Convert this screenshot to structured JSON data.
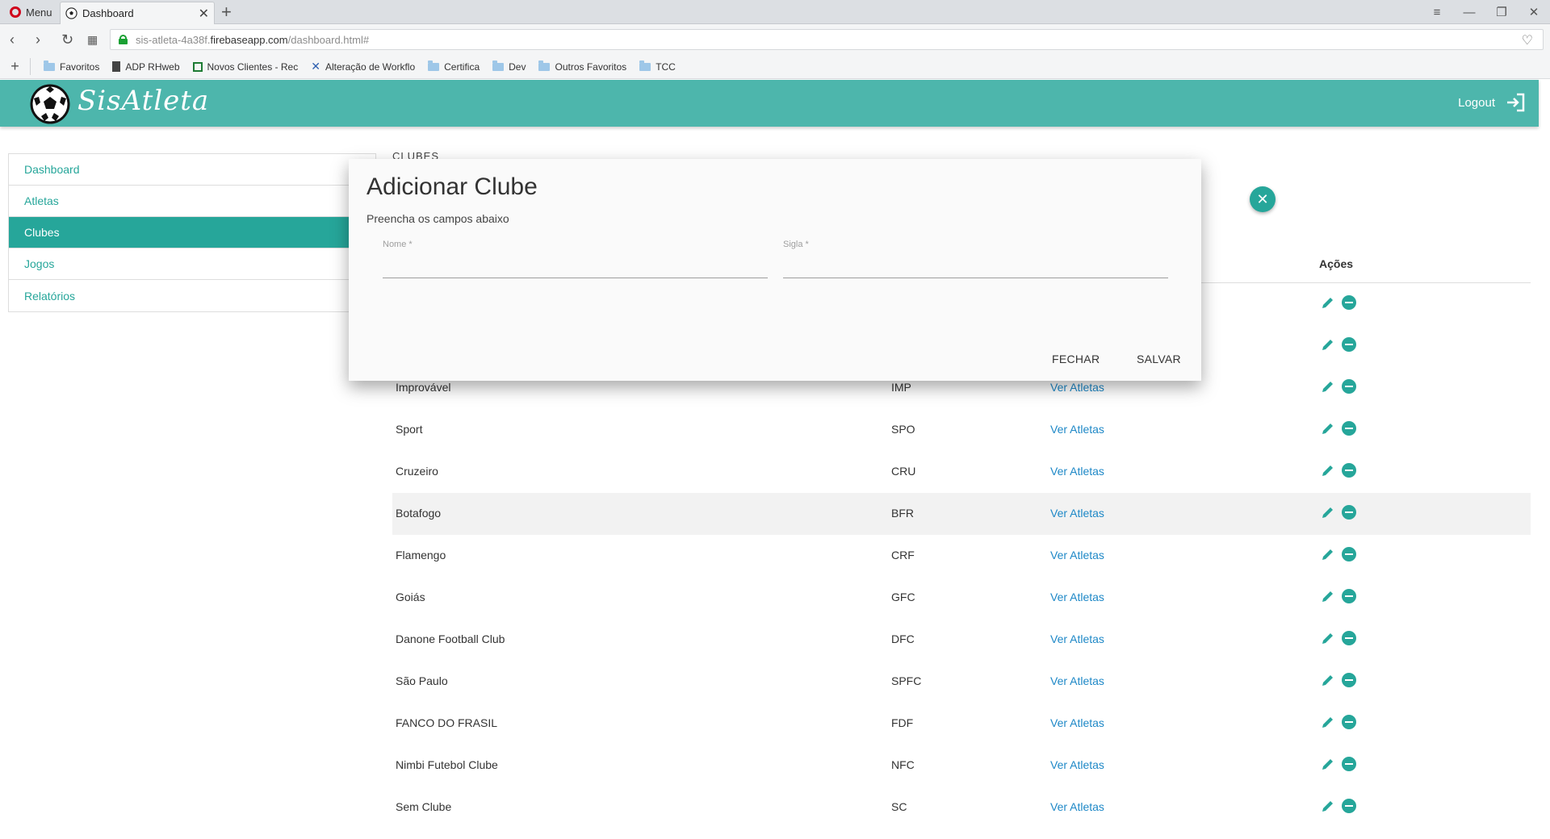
{
  "browser": {
    "menu_label": "Menu",
    "tab_title": "Dashboard",
    "url_prefix": "sis-atleta-4a38f.",
    "url_domain": "firebaseapp.com",
    "url_path": "/dashboard.html#",
    "bookmarks": [
      "Favoritos",
      "ADP RHweb",
      "Novos Clientes - Rec",
      "Alteração de Workflo",
      "Certifica",
      "Dev",
      "Outros Favoritos",
      "TCC"
    ]
  },
  "app": {
    "brand": "SisAtleta",
    "logout_label": "Logout",
    "accent_color": "#4db6ac"
  },
  "sidebar": {
    "items": [
      {
        "label": "Dashboard"
      },
      {
        "label": "Atletas"
      },
      {
        "label": "Clubes"
      },
      {
        "label": "Jogos"
      },
      {
        "label": "Relatórios"
      }
    ],
    "active": "Clubes"
  },
  "page": {
    "title": "CLUBES"
  },
  "table": {
    "actions_header": "Ações",
    "rows": [
      {
        "nome": "",
        "sigla": "",
        "link": ""
      },
      {
        "nome": "",
        "sigla": "",
        "link": ""
      },
      {
        "nome": "Improvável",
        "sigla": "IMP",
        "link": "Ver Atletas"
      },
      {
        "nome": "Sport",
        "sigla": "SPO",
        "link": "Ver Atletas"
      },
      {
        "nome": "Cruzeiro",
        "sigla": "CRU",
        "link": "Ver Atletas"
      },
      {
        "nome": "Botafogo",
        "sigla": "BFR",
        "link": "Ver Atletas"
      },
      {
        "nome": "Flamengo",
        "sigla": "CRF",
        "link": "Ver Atletas"
      },
      {
        "nome": "Goiás",
        "sigla": "GFC",
        "link": "Ver Atletas"
      },
      {
        "nome": "Danone Football Club",
        "sigla": "DFC",
        "link": "Ver Atletas"
      },
      {
        "nome": "São Paulo",
        "sigla": "SPFC",
        "link": "Ver Atletas"
      },
      {
        "nome": "FANCO DO FRASIL",
        "sigla": "FDF",
        "link": "Ver Atletas"
      },
      {
        "nome": "Nimbi Futebol Clube",
        "sigla": "NFC",
        "link": "Ver Atletas"
      },
      {
        "nome": "Sem Clube",
        "sigla": "SC",
        "link": "Ver Atletas"
      }
    ]
  },
  "modal": {
    "title": "Adicionar Clube",
    "subtitle": "Preencha os campos abaixo",
    "nome_label": "Nome *",
    "nome_value": "",
    "sigla_label": "Sigla *",
    "sigla_value": "",
    "close_label": "FECHAR",
    "save_label": "SALVAR"
  }
}
